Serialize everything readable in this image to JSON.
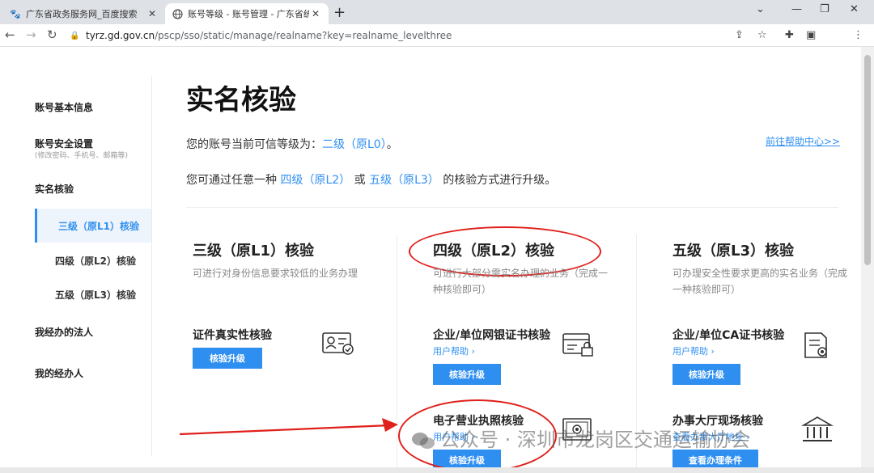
{
  "browser": {
    "tabs": [
      {
        "title": "广东省政务服务网_百度搜索",
        "favicon": "baidu-paw-icon",
        "active": false
      },
      {
        "title": "账号等级 - 账号管理 - 广东省统",
        "favicon": "globe-icon",
        "active": true
      }
    ],
    "new_tab": "+",
    "url_host": "tyrz.gd.gov.cn",
    "url_path": "/pscp/sso/static/manage/realname?key=realname_levelthree"
  },
  "sidebar": {
    "items": [
      {
        "label": "账号基本信息"
      },
      {
        "label": "账号安全设置",
        "sub": "(修改密码、手机号、邮箱等)"
      },
      {
        "label": "实名核验"
      },
      {
        "label": "三级（原L1）核验",
        "active": true
      },
      {
        "label": "四级（原L2）核验"
      },
      {
        "label": "五级（原L3）核验"
      },
      {
        "label": "我经办的法人"
      },
      {
        "label": "我的经办人"
      }
    ]
  },
  "main": {
    "title": "实名核验",
    "level_prefix": "您的账号当前可信等级为：",
    "level_value": "二级（原L0）",
    "level_suffix": "。",
    "help_center": "前往帮助中心>>",
    "upgrade_prefix": "您可通过任意一种",
    "upgrade_opt1": "四级（原L2）",
    "upgrade_or": "或",
    "upgrade_opt2": "五级（原L3）",
    "upgrade_suffix": "的核验方式进行升级。",
    "columns": [
      {
        "title": "三级（原L1）核验",
        "desc": "可进行对身份信息要求较低的业务办理",
        "methods": [
          {
            "title": "证件真实性核验",
            "button": "核验升级",
            "icon": "id-card-check-icon"
          }
        ]
      },
      {
        "title": "四级（原L2）核验",
        "desc": "可进行大部分需实名办理的业务（完成一种核验即可）",
        "methods": [
          {
            "title": "企业/单位网银证书核验",
            "help": "用户帮助 ›",
            "button": "核验升级",
            "icon": "bank-card-lock-icon"
          },
          {
            "title": "电子营业执照核验",
            "help": "用户帮助 ›",
            "button": "核验升级",
            "icon": "business-license-icon"
          }
        ]
      },
      {
        "title": "五级（原L3）核验",
        "desc": "可办理安全性要求更高的实名业务（完成一种核验即可）",
        "methods": [
          {
            "title": "企业/单位CA证书核验",
            "help": "用户帮助 ›",
            "button": "核验升级",
            "icon": "certificate-icon"
          },
          {
            "title": "办事大厅现场核验",
            "help": "查看办事大厅地址 ›",
            "button": "查看办理条件",
            "icon": "government-building-icon"
          }
        ]
      }
    ]
  },
  "watermark": "公众号 · 深圳市龙岗区交通运输协会",
  "annotation_color": "#e0201b",
  "accent_color": "#2f8ff0"
}
